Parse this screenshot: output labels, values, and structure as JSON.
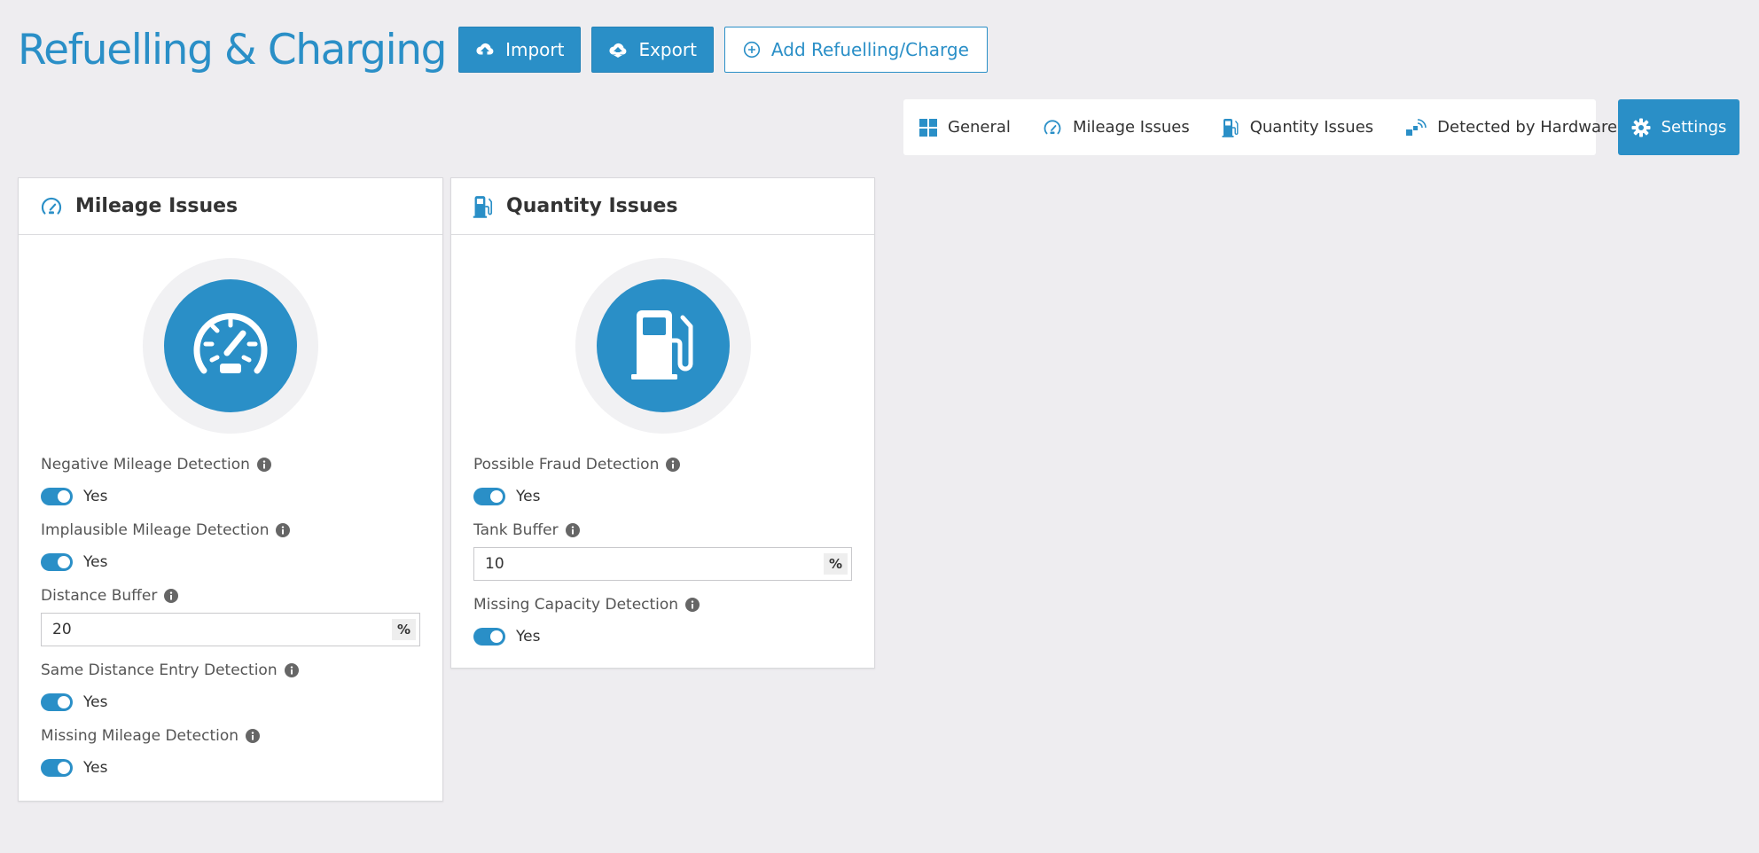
{
  "header": {
    "title": "Refuelling & Charging",
    "import_label": "Import",
    "export_label": "Export",
    "add_label": "Add Refuelling/Charge"
  },
  "tabs": [
    {
      "label": "General",
      "icon": "grid-icon"
    },
    {
      "label": "Mileage Issues",
      "icon": "speedometer-icon"
    },
    {
      "label": "Quantity Issues",
      "icon": "fuel-pump-icon"
    },
    {
      "label": "Detected by Hardware",
      "icon": "signal-icon"
    }
  ],
  "settings_label": "Settings",
  "colors": {
    "accent": "#2a8fc7",
    "background": "#eeedf0"
  },
  "mileage": {
    "title": "Mileage Issues",
    "negative_label": "Negative Mileage Detection",
    "negative_value": "Yes",
    "implausible_label": "Implausible Mileage Detection",
    "implausible_value": "Yes",
    "buffer_label": "Distance Buffer",
    "buffer_value": "20",
    "buffer_unit": "%",
    "same_label": "Same Distance Entry Detection",
    "same_value": "Yes",
    "missing_label": "Missing Mileage Detection",
    "missing_value": "Yes"
  },
  "quantity": {
    "title": "Quantity Issues",
    "fraud_label": "Possible Fraud Detection",
    "fraud_value": "Yes",
    "tank_label": "Tank Buffer",
    "tank_value": "10",
    "tank_unit": "%",
    "capacity_label": "Missing Capacity Detection",
    "capacity_value": "Yes"
  }
}
